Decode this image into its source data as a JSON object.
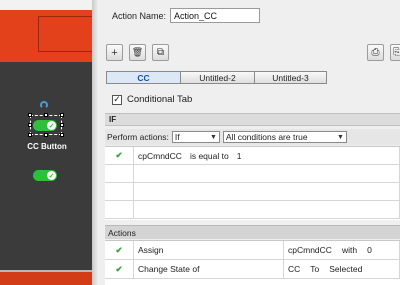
{
  "stage": {
    "button_label": "CC Button"
  },
  "action": {
    "name_label": "Action Name:",
    "name_value": "Action_CC"
  },
  "toolbar": {
    "add_glyph": "+",
    "delete_glyph": "🗑",
    "duplicate_glyph": "⧉",
    "right1_glyph": "⎙",
    "right2_glyph": "⎘"
  },
  "tabs": [
    {
      "label": "CC"
    },
    {
      "label": "Untitled-2"
    },
    {
      "label": "Untitled-3"
    }
  ],
  "conditional_tab": {
    "checked_glyph": "✓",
    "label": "Conditional Tab"
  },
  "if_section": {
    "title": "IF",
    "perform_label": "Perform actions:",
    "perform_value": "If",
    "conditions_value": "All conditions are true",
    "conditions": [
      {
        "check": "✔",
        "variable": "cpCmndCC",
        "operator": "is equal to",
        "value": "1"
      }
    ]
  },
  "actions_section": {
    "title": "Actions",
    "rows": [
      {
        "check": "✔",
        "action": "Assign",
        "target": "cpCmndCC",
        "with": "with",
        "value": "0"
      },
      {
        "check": "✔",
        "action": "Change State of",
        "target": "CC",
        "with": "To",
        "value": "Selected"
      }
    ]
  },
  "colors": {
    "accent_red": "#e2411c",
    "toggle_green": "#2fbf3a",
    "check_green": "#38a238",
    "active_tab_text": "#1b4fa0"
  }
}
